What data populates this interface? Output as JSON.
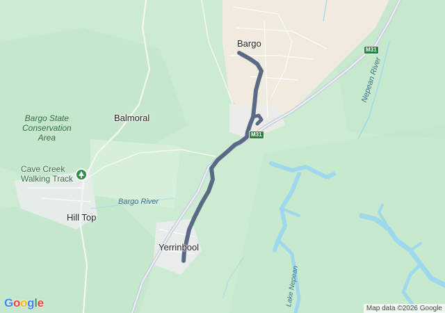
{
  "map": {
    "towns": {
      "bargo": "Bargo",
      "balmoral": "Balmoral",
      "hill_top": "Hill Top",
      "yerrinbool": "Yerrinbool"
    },
    "parks": {
      "bargo_state_conservation_area": [
        "Bargo State",
        "Conservation",
        "Area"
      ]
    },
    "pois": {
      "cave_creek": [
        "Cave Creek",
        "Walking Track"
      ]
    },
    "water_labels": {
      "bargo_river": "Bargo River",
      "nepean_river": "Nepean River",
      "lake_nepean": "Lake Nepean"
    },
    "road_shields": [
      "M31",
      "M31"
    ],
    "logo": "Google",
    "attribution": "Map data ©2026 Google",
    "colors": {
      "forest": "#cdebd2",
      "park_dark": "#b9e1c0",
      "water": "#9fd8ec",
      "urban": "#f0eadf",
      "motorway": "#c7d0db",
      "route": "#5a6a85",
      "shield_green": "#2f7d3f"
    },
    "route_style": "dark blue-grey highlighted route from Bargo south to Yerrinbool"
  }
}
